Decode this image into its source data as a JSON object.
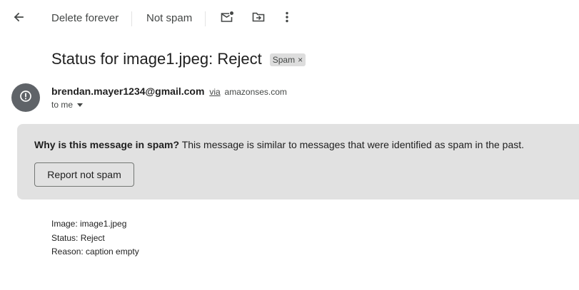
{
  "toolbar": {
    "back_icon": "arrow-left-icon",
    "delete_forever_label": "Delete forever",
    "not_spam_label": "Not spam",
    "mark_unread_icon": "mark-unread-icon",
    "move_to_icon": "move-to-folder-icon",
    "more_icon": "more-vertical-icon"
  },
  "message": {
    "subject": "Status for image1.jpeg: Reject",
    "label": "Spam",
    "label_remove_glyph": "×",
    "sender_email": "brendan.mayer1234@gmail.com",
    "via_text": "via",
    "via_domain": "amazonses.com",
    "recipient_text": "to me",
    "avatar_icon": "alert-icon"
  },
  "spam_banner": {
    "question": "Why is this message in spam?",
    "explanation": " This message is similar to messages that were identified as spam in the past.",
    "button_label": "Report not spam"
  },
  "body": {
    "lines": [
      "Image: image1.jpeg",
      "Status: Reject",
      "Reason: caption empty"
    ]
  },
  "colors": {
    "banner_bg": "#e1e1e1",
    "avatar_bg": "#5f6368",
    "chip_bg": "#dddddd"
  }
}
